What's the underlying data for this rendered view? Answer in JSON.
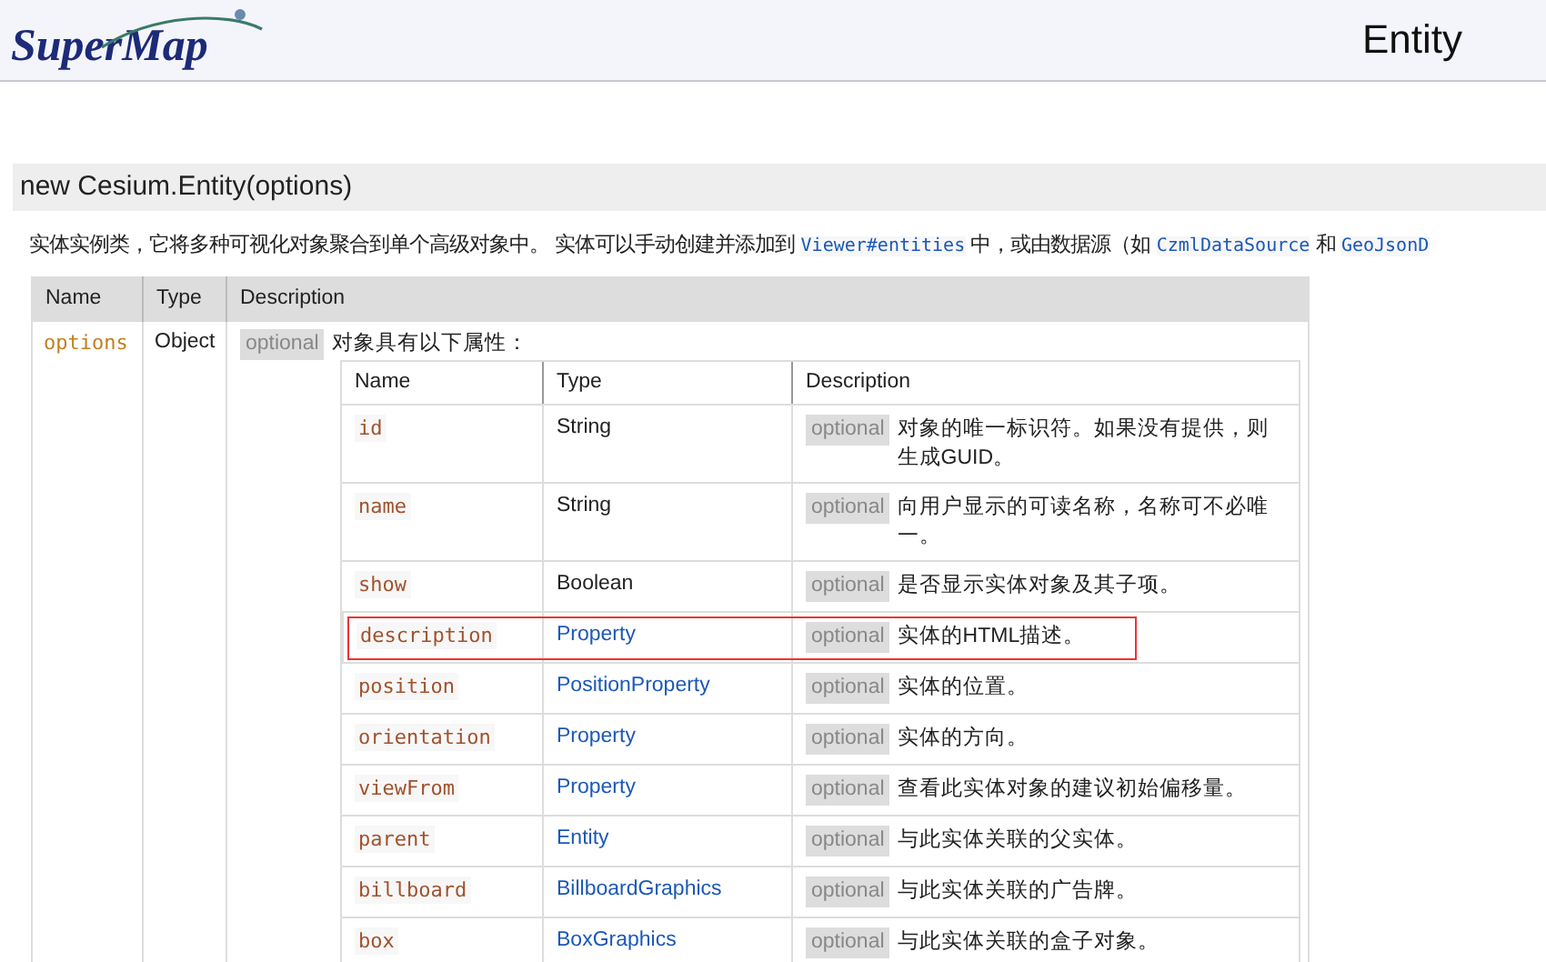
{
  "header": {
    "logo": "SuperMap",
    "title": "Entity"
  },
  "signature": "new Cesium.Entity(options)",
  "intro": [
    {
      "kind": "text",
      "text": "实体实例类，它将多种可视化对象聚合到单个高级对象中。 实体可以手动创建并添加到 "
    },
    {
      "kind": "link",
      "text": "Viewer#entities"
    },
    {
      "kind": "text",
      "text": " 中，或由数据源（如 "
    },
    {
      "kind": "link",
      "text": "CzmlDataSource"
    },
    {
      "kind": "text",
      "text": " 和 "
    },
    {
      "kind": "link",
      "text": "GeoJsonD"
    }
  ],
  "params_table": {
    "columns": [
      "Name",
      "Type",
      "Description"
    ],
    "rows": [
      {
        "name": "options",
        "type": "Object",
        "tag": "optional",
        "description": "对象具有以下属性：",
        "properties": {
          "columns": [
            "Name",
            "Type",
            "Description"
          ],
          "rows": [
            {
              "name": "id",
              "type": "String",
              "type_link": false,
              "tag": "optional",
              "description": "对象的唯一标识符。如果没有提供，则生成GUID。",
              "highlighted": false
            },
            {
              "name": "name",
              "type": "String",
              "type_link": false,
              "tag": "optional",
              "description": "向用户显示的可读名称，名称可不必唯一。",
              "highlighted": false
            },
            {
              "name": "show",
              "type": "Boolean",
              "type_link": false,
              "tag": "optional",
              "description": "是否显示实体对象及其子项。",
              "highlighted": false
            },
            {
              "name": "description",
              "type": "Property",
              "type_link": true,
              "tag": "optional",
              "description": "实体的HTML描述。",
              "highlighted": true
            },
            {
              "name": "position",
              "type": "PositionProperty",
              "type_link": true,
              "tag": "optional",
              "description": "实体的位置。",
              "highlighted": false
            },
            {
              "name": "orientation",
              "type": "Property",
              "type_link": true,
              "tag": "optional",
              "description": "实体的方向。",
              "highlighted": false
            },
            {
              "name": "viewFrom",
              "type": "Property",
              "type_link": true,
              "tag": "optional",
              "description": "查看此实体对象的建议初始偏移量。",
              "highlighted": false
            },
            {
              "name": "parent",
              "type": "Entity",
              "type_link": true,
              "tag": "optional",
              "description": "与此实体关联的父实体。",
              "highlighted": false
            },
            {
              "name": "billboard",
              "type": "BillboardGraphics",
              "type_link": true,
              "tag": "optional",
              "description": "与此实体关联的广告牌。",
              "highlighted": false
            },
            {
              "name": "box",
              "type": "BoxGraphics",
              "type_link": true,
              "tag": "optional",
              "description": "与此实体关联的盒子对象。",
              "highlighted": false
            }
          ]
        }
      }
    ]
  }
}
